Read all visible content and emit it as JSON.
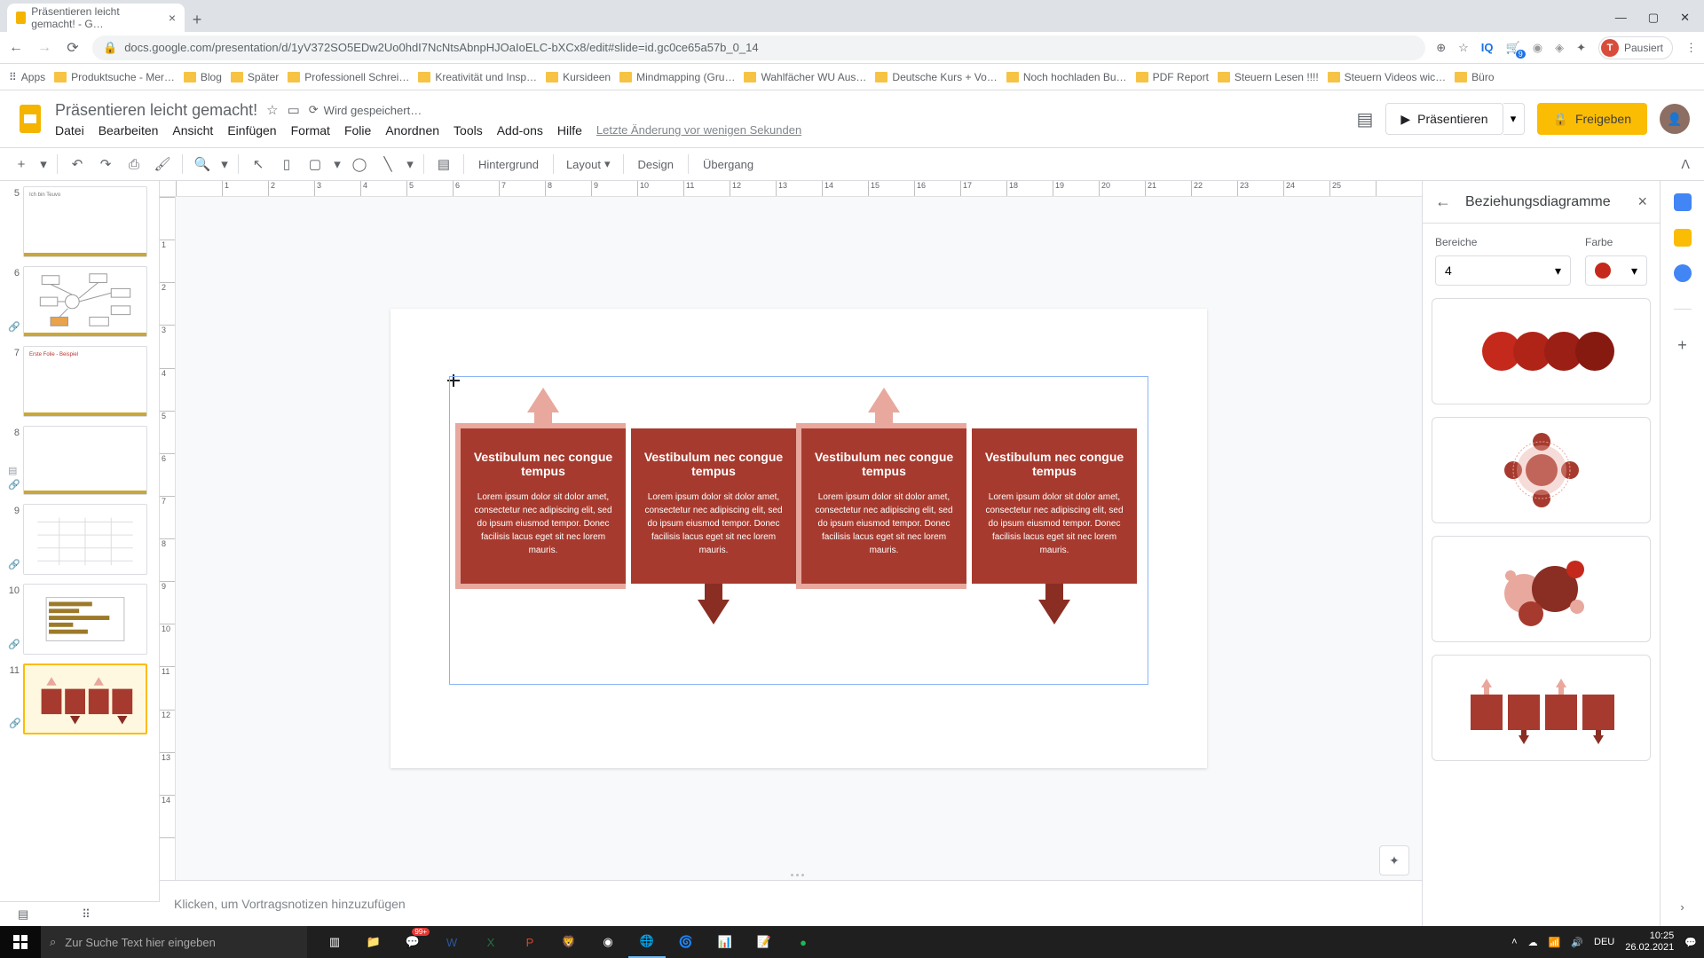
{
  "browser": {
    "tab_title": "Präsentieren leicht gemacht! - G…",
    "url": "docs.google.com/presentation/d/1yV372SO5EDw2Uo0hdI7NcNtsAbnpHJOaIoELC-bXCx8/edit#slide=id.gc0ce65a57b_0_14",
    "profile_status": "Pausiert",
    "bookmarks": [
      "Apps",
      "Produktsuche - Mer…",
      "Blog",
      "Später",
      "Professionell Schrei…",
      "Kreativität und Insp…",
      "Kursideen",
      "Mindmapping  (Gru…",
      "Wahlfächer WU Aus…",
      "Deutsche Kurs + Vo…",
      "Noch hochladen Bu…",
      "PDF Report",
      "Steuern Lesen !!!!",
      "Steuern Videos wic…",
      "Büro"
    ]
  },
  "header": {
    "doc_title": "Präsentieren leicht gemacht!",
    "saving": "Wird gespeichert…",
    "menu": [
      "Datei",
      "Bearbeiten",
      "Ansicht",
      "Einfügen",
      "Format",
      "Folie",
      "Anordnen",
      "Tools",
      "Add-ons",
      "Hilfe"
    ],
    "last_change": "Letzte Änderung vor wenigen Sekunden",
    "present": "Präsentieren",
    "share": "Freigeben"
  },
  "toolbar": {
    "background": "Hintergrund",
    "layout": "Layout",
    "design": "Design",
    "transition": "Übergang"
  },
  "filmstrip": {
    "slides": [
      {
        "num": "5",
        "label": "Ich bin Teuvo"
      },
      {
        "num": "6",
        "label": "Mindmap"
      },
      {
        "num": "7",
        "label": "Erste Folie - Beispiel"
      },
      {
        "num": "8",
        "label": ""
      },
      {
        "num": "9",
        "label": ""
      },
      {
        "num": "10",
        "label": ""
      },
      {
        "num": "11",
        "label": ""
      }
    ]
  },
  "slide": {
    "boxes": [
      {
        "title": "Vestibulum nec congue tempus",
        "body": "Lorem ipsum dolor sit dolor amet, consectetur nec adipiscing elit, sed do ipsum eiusmod tempor. Donec facilisis lacus eget sit nec lorem mauris."
      },
      {
        "title": "Vestibulum nec congue tempus",
        "body": "Lorem ipsum dolor sit dolor amet, consectetur nec adipiscing elit, sed do ipsum eiusmod tempor. Donec facilisis lacus eget sit nec lorem mauris."
      },
      {
        "title": "Vestibulum nec congue tempus",
        "body": "Lorem ipsum dolor sit dolor amet, consectetur nec adipiscing elit, sed do ipsum eiusmod tempor. Donec facilisis lacus eget sit nec lorem mauris."
      },
      {
        "title": "Vestibulum nec congue tempus",
        "body": "Lorem ipsum dolor sit dolor amet, consectetur nec adipiscing elit, sed do ipsum eiusmod tempor. Donec facilisis lacus eget sit nec lorem mauris."
      }
    ]
  },
  "notes": {
    "placeholder": "Klicken, um Vortragsnotizen hinzuzufügen"
  },
  "panel": {
    "title": "Beziehungsdiagramme",
    "areas_label": "Bereiche",
    "areas_value": "4",
    "color_label": "Farbe"
  },
  "taskbar": {
    "search_placeholder": "Zur Suche Text hier eingeben",
    "lang": "DEU",
    "time": "10:25",
    "date": "26.02.2021",
    "msg_count": "99+"
  }
}
